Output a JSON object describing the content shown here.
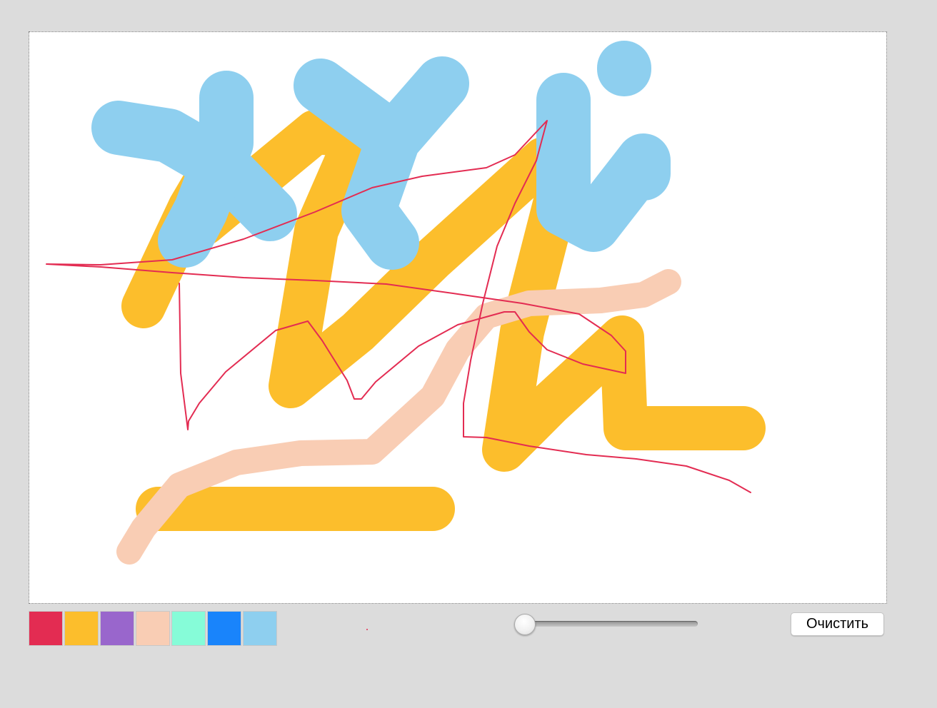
{
  "palette": {
    "colors": [
      "#e32c52",
      "#fcbe2c",
      "#9966cc",
      "#f9cdb4",
      "#86fcd8",
      "#1984fb",
      "#8ecfef"
    ],
    "selected_index": 0
  },
  "brush": {
    "color": "#e32c52"
  },
  "size_slider": {
    "value": 0
  },
  "clear_button": {
    "label": "Очистить"
  },
  "strokes": {
    "orange": "#fcbe2c",
    "light_blue": "#8ecfef",
    "peach": "#f9cdb4",
    "red": "#e32c52"
  }
}
